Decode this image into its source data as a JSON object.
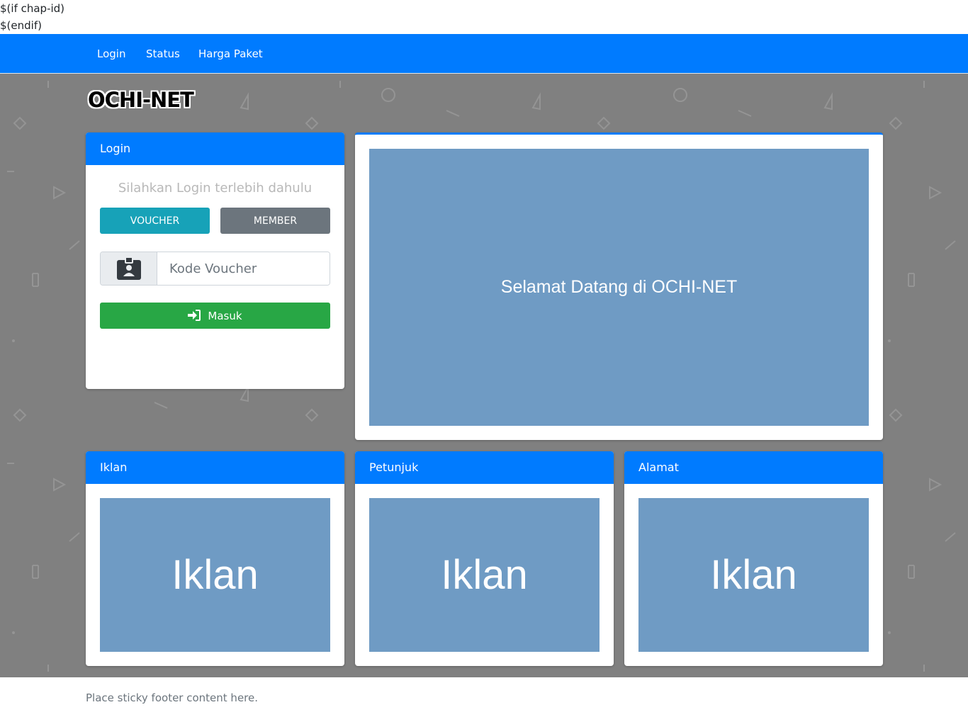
{
  "raw_template": {
    "line1": "$(if chap-id)",
    "line2": "$(endif)"
  },
  "navbar": {
    "links": [
      "Login",
      "Status",
      "Harga Paket"
    ],
    "color": "#007bff"
  },
  "brand": "OCHI-NET",
  "login_card": {
    "title": "Login",
    "prompt": "Silahkan Login terlebih dahulu",
    "voucher_button": "VOUCHER",
    "member_button": "MEMBER",
    "voucher_placeholder": "Kode Voucher",
    "submit_button": "Masuk",
    "icons": {
      "input_addon": "id-badge-icon",
      "submit": "sign-in-icon"
    }
  },
  "welcome": {
    "text": "Selamat Datang di OCHI-NET"
  },
  "info_cards": [
    {
      "title": "Iklan",
      "content": "Iklan"
    },
    {
      "title": "Petunjuk",
      "content": "Iklan"
    },
    {
      "title": "Alamat",
      "content": "Iklan"
    }
  ],
  "footer": {
    "text": "Place sticky footer content here."
  },
  "colors": {
    "primary": "#007bff",
    "info": "#17a2b8",
    "secondary": "#6c757d",
    "success": "#28a745",
    "placeholder_box": "#6f9bc4",
    "background": "#808080"
  }
}
